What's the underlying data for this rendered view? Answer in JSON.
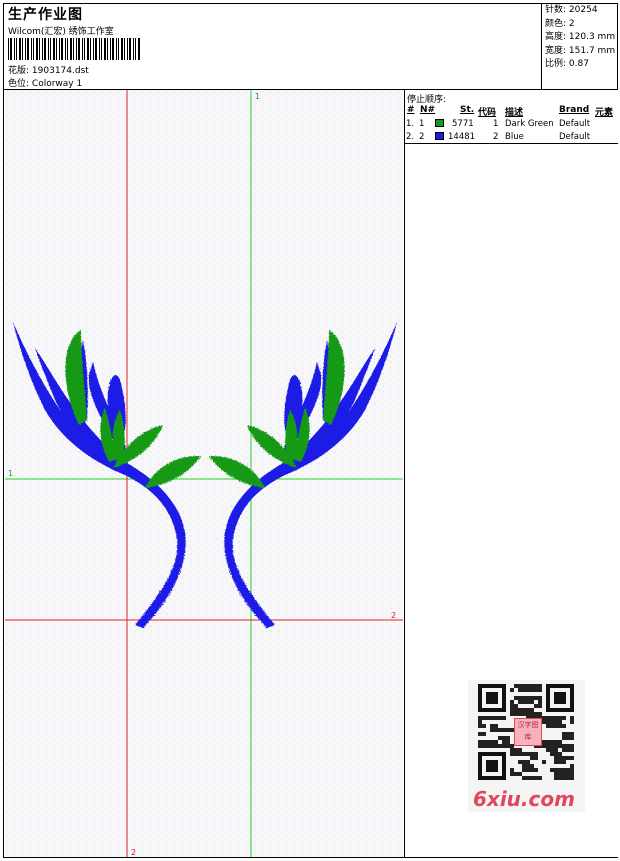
{
  "header": {
    "title": "生产作业图",
    "company": "Wilcom(汇宏) 绣饰工作室",
    "design_label": "花版:",
    "design_file": "1903174.dst",
    "colorway_label": "色位:",
    "colorway": "Colorway 1"
  },
  "stats": {
    "stitches_label": "针数:",
    "stitches": "20254",
    "colors_label": "颜色:",
    "colors": "2",
    "height_label": "高度:",
    "height": "120.3 mm",
    "width_label": "宽度:",
    "width": "151.7 mm",
    "ratio_label": "比例:",
    "ratio": "0.87"
  },
  "stop_sequence": {
    "title": "停止顺序:",
    "headers": [
      "#",
      "N#",
      "St.",
      "代码",
      "描述",
      "Brand",
      "元素"
    ],
    "rows": [
      {
        "index": "1.",
        "n": "1",
        "color": "#179a17",
        "stitches": "5771",
        "code": "1",
        "description": "Dark Green",
        "brand": "Default"
      },
      {
        "index": "2.",
        "n": "2",
        "color": "#1a1ae6",
        "stitches": "14481",
        "code": "2",
        "description": "Blue",
        "brand": "Default"
      }
    ]
  },
  "guides": {
    "v_green_label": "1",
    "h_green_label": "1",
    "h_red_label": "2",
    "v_red_label": "2"
  },
  "colors": {
    "green": "#179a17",
    "blue": "#1a1ae6",
    "guide_red": "#e02020",
    "guide_green": "#20d020"
  },
  "watermark": {
    "text": "6xiu.com",
    "qr_center": "汉字图库"
  }
}
